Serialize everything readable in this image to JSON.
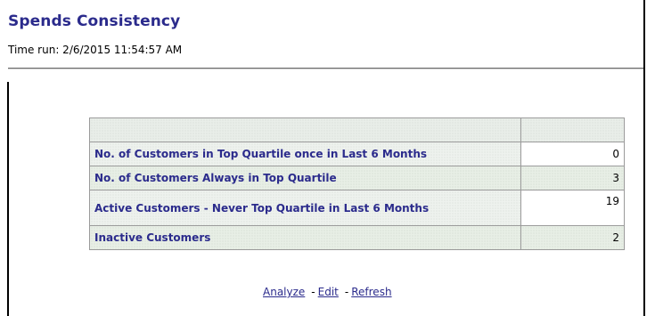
{
  "panel": {
    "title": "Spends Consistency",
    "time_run": "Time run: 2/6/2015 11:54:57 AM"
  },
  "table": {
    "rows": [
      {
        "label": "No. of Customers in Top Quartile once in Last 6 Months",
        "value": "0"
      },
      {
        "label": "No. of Customers Always in Top Quartile",
        "value": "3"
      },
      {
        "label": "Active Customers - Never Top Quartile in Last 6 Months",
        "value": "19"
      },
      {
        "label": "Inactive Customers",
        "value": "2"
      }
    ]
  },
  "links": {
    "analyze": "Analyze",
    "edit": "Edit",
    "refresh": "Refresh",
    "separator": "-"
  },
  "colors": {
    "title": "#2b2b8c",
    "label": "#2b2b8c",
    "shaded_row": "#e8efe6"
  }
}
